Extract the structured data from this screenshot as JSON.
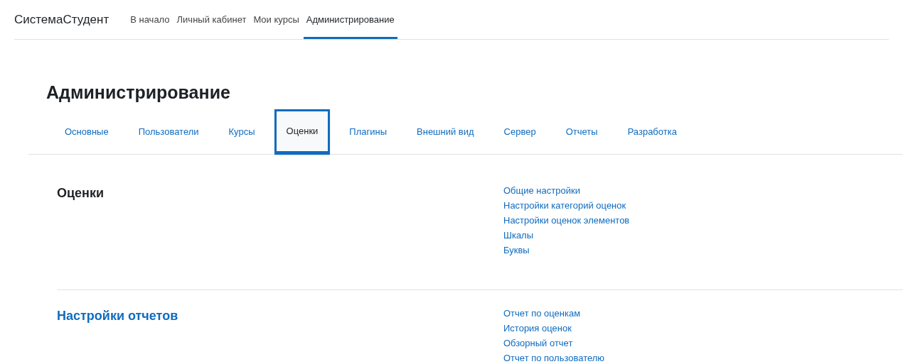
{
  "site_name": "СистемаСтудент",
  "nav": [
    {
      "label": "В начало",
      "selected": false
    },
    {
      "label": "Личный кабинет",
      "selected": false
    },
    {
      "label": "Мои курсы",
      "selected": false
    },
    {
      "label": "Администрирование",
      "selected": true
    }
  ],
  "page_title": "Администрирование",
  "tabs": [
    {
      "label": "Основные",
      "selected": false
    },
    {
      "label": "Пользователи",
      "selected": false
    },
    {
      "label": "Курсы",
      "selected": false
    },
    {
      "label": "Оценки",
      "selected": true
    },
    {
      "label": "Плагины",
      "selected": false
    },
    {
      "label": "Внешний вид",
      "selected": false
    },
    {
      "label": "Сервер",
      "selected": false
    },
    {
      "label": "Отчеты",
      "selected": false
    },
    {
      "label": "Разработка",
      "selected": false
    }
  ],
  "sections": [
    {
      "title": "Оценки",
      "kind": "heading",
      "links": [
        "Общие настройки",
        "Настройки категорий оценок",
        "Настройки оценок элементов",
        "Шкалы",
        "Буквы"
      ]
    },
    {
      "title": "Настройки отчетов",
      "kind": "link",
      "links": [
        "Отчет по оценкам",
        "История оценок",
        "Обзорный отчет",
        "Отчет по пользователю"
      ]
    }
  ]
}
